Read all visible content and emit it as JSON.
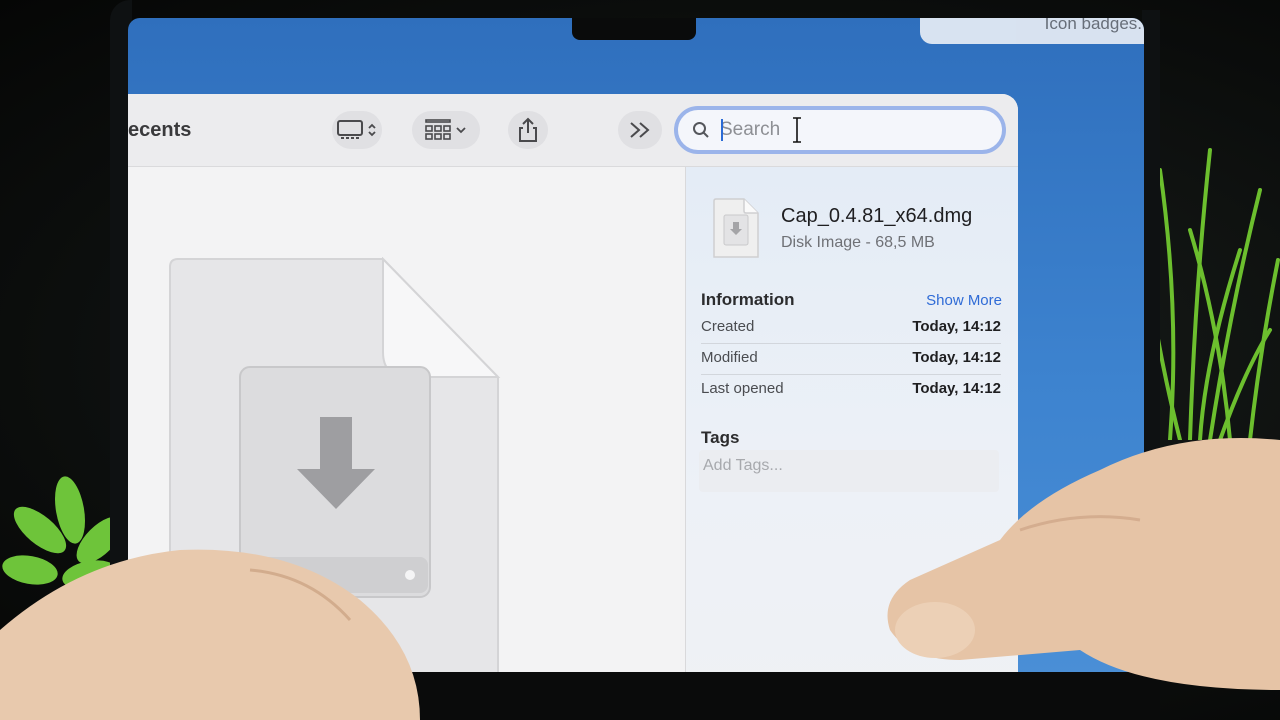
{
  "notification": {
    "text": "Icon badges."
  },
  "finder": {
    "title": "ecents",
    "toolbar": {
      "view_icon": "monitor-icon",
      "group_icon": "grid-icon",
      "share_icon": "share-icon",
      "more_icon": "chevron-double-right-icon"
    },
    "search": {
      "placeholder": "Search",
      "value": ""
    }
  },
  "preview": {
    "file_name": "Cap_0.4.81_x64.dmg",
    "file_kind": "Disk Image - 68,5 MB",
    "info_heading": "Information",
    "show_more": "Show More",
    "rows": [
      {
        "label": "Created",
        "value": "Today, 14:12"
      },
      {
        "label": "Modified",
        "value": "Today, 14:12"
      },
      {
        "label": "Last opened",
        "value": "Today, 14:12"
      }
    ],
    "tags_heading": "Tags",
    "tags_placeholder": "Add Tags..."
  },
  "colors": {
    "accent": "#2f6bd6",
    "focus_ring": "#9bb4ea",
    "desktop_blue": "#3d83cf"
  }
}
